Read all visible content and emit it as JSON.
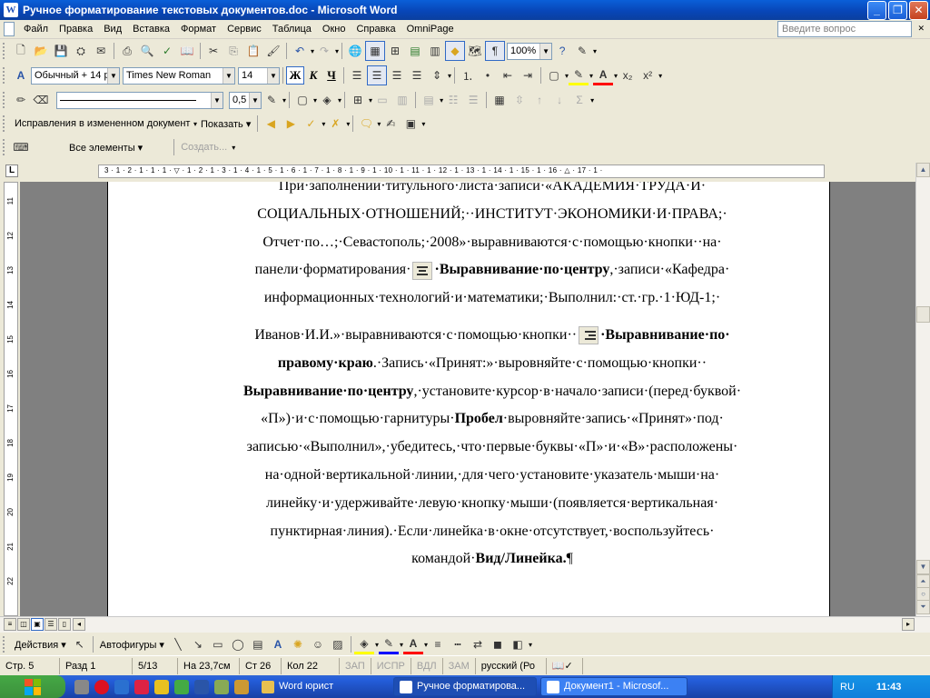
{
  "window": {
    "title": "Ручное форматирование текстовых документов.doc - Microsoft Word",
    "app_icon": "W"
  },
  "menu": {
    "items": [
      "Файл",
      "Правка",
      "Вид",
      "Вставка",
      "Формат",
      "Сервис",
      "Таблица",
      "Окно",
      "Справка",
      "OmniPage"
    ],
    "help_placeholder": "Введите вопрос"
  },
  "standard_toolbar": {
    "zoom": "100%"
  },
  "formatting_toolbar": {
    "style": "Обычный + 14 р",
    "font": "Times New Roman",
    "size": "14",
    "bold_label": "Ж",
    "italic_label": "К",
    "underline_label": "Ч"
  },
  "drawing_toolbar_top": {
    "line_width": "0,5"
  },
  "reviewing_toolbar": {
    "display_mode": "Исправления в измененном документ",
    "show_label": "Показать"
  },
  "elements_toolbar": {
    "all_elements": "Все элементы",
    "create": "Создать..."
  },
  "ruler": {
    "marks": "3 · 1 · 2 · 1 · 1 · 1 · ▽ · 1 · 2 · 1 · 3 · 1 · 4 · 1 · 5 · 1 · 6 · 1 · 7 · 1 · 8 · 1 · 9 · 1 · 10 · 1 · 11 · 1 · 12 · 1 · 13 · 1 · 14 · 1 · 15 · 1 · 16 · △ · 17 · 1 ·",
    "vertical_marks": [
      "11",
      "12",
      "13",
      "14",
      "15",
      "16",
      "17",
      "18",
      "19",
      "20",
      "21",
      "22"
    ]
  },
  "document": {
    "lines": [
      "При·заполнении·титульного·листа·записи·«АКАДЕМИЯ·ТРУДА·И·",
      "СОЦИАЛЬНЫХ·ОТНОШЕНИЙ;··ИНСТИТУТ·ЭКОНОМИКИ·И·ПРАВА;·",
      "Отчет·по…;·Севастополь;·2008»·выравниваются·с·помощью·кнопки··на·"
    ],
    "line4_pre": "панели·форматирования·",
    "line4_bold": "·Выравнивание·по·центру",
    "line4_post": ",·записи·«Кафедра·",
    "line5": "информационных·технологий·и·математики;·Выполнил:·ст.·гр.·1·ЮД-1;·",
    "line6_pre": "Иванов·И.И.»·выравниваются·с·помощью·кнопки··",
    "line6_bold": "·Выравнивание·по·",
    "line7_bold": "правому·краю",
    "line7_post": ".·Запись·«Принят:»·выровняйте·с·помощью·кнопки··",
    "line8_bold": "Выравнивание·по·центру",
    "line8_post": ",·установите·курсор·в·начало·записи·(перед·буквой·",
    "line9_pre": "«П»)·и·с·помощью·гарнитуры·",
    "line9_bold": "Пробел",
    "line9_post": "·выровняйте·запись·«Принят»·под·",
    "line10": "записью·«Выполнил»,·убедитесь,·что·первые·буквы·«П»·и·«В»·расположены·",
    "line11": "на·одной·вертикальной·линии,·для·чего·установите·указатель·мыши·на·",
    "line12": "линейку·и·удерживайте·левую·кнопку·мыши·(появляется·вертикальная·",
    "line13": "пунктирная·линия).·Если·линейка·в·окне·отсутствует,·воспользуйтесь·",
    "line14_pre": "командой·",
    "line14_bold": "Вид/Линейка.",
    "line14_mark": "¶"
  },
  "drawing_toolbar": {
    "actions": "Действия",
    "autoshapes": "Автофигуры"
  },
  "status": {
    "page": "Стр.  5",
    "section": "Разд  1",
    "pages": "5/13",
    "position": "На  23,7см",
    "line": "Ст  26",
    "column": "Кол  22",
    "rec": "ЗАП",
    "trk": "ИСПР",
    "ext": "ВДЛ",
    "ovr": "ЗАМ",
    "language": "русский (Ро"
  },
  "taskbar": {
    "folder_button": "Word юрист",
    "task1": "Ручное форматирова...",
    "task2": "Документ1 - Microsof...",
    "lang": "RU",
    "clock": "11:43"
  }
}
